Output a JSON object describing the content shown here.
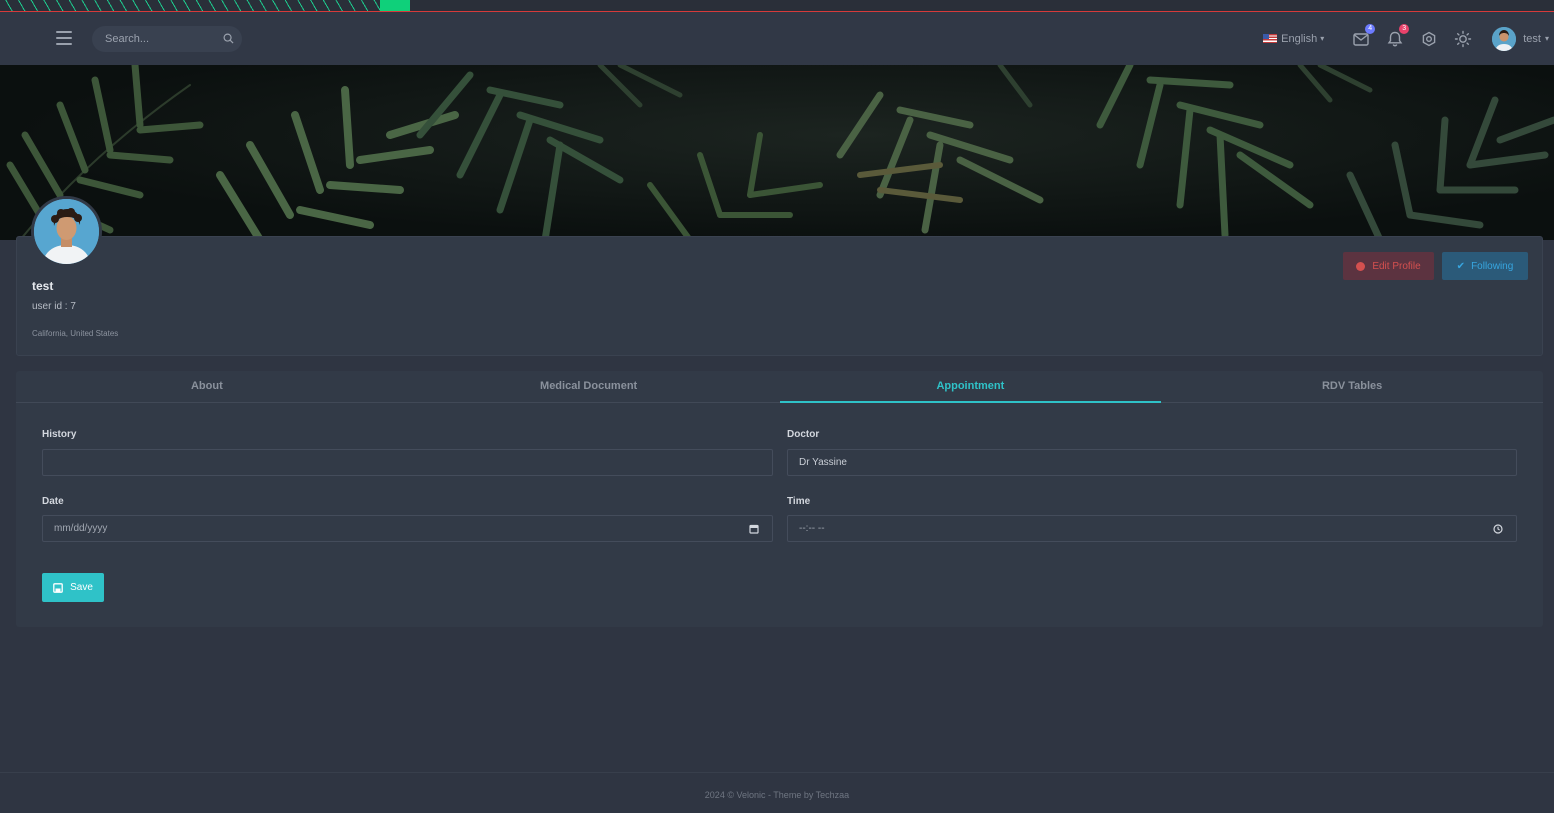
{
  "topbar": {
    "search_placeholder": "Search...",
    "language": "English",
    "messages_badge": "4",
    "notifications_badge": "3",
    "user_name": "test"
  },
  "profile": {
    "name": "test",
    "user_id": "user id : 7",
    "location": "California, United States",
    "edit_label": "Edit Profile",
    "follow_label": "Following"
  },
  "tabs": [
    {
      "label": "About",
      "active": false
    },
    {
      "label": "Medical Document",
      "active": false
    },
    {
      "label": "Appointment",
      "active": true
    },
    {
      "label": "RDV Tables",
      "active": false
    }
  ],
  "form": {
    "history_label": "History",
    "history_value": "",
    "doctor_label": "Doctor",
    "doctor_value": "Dr Yassine",
    "date_label": "Date",
    "date_placeholder": "mm/dd/yyyy",
    "time_label": "Time",
    "time_placeholder": "--:-- --",
    "save_label": "Save"
  },
  "footer": {
    "text": "2024 © Velonic - Theme by Techzaa"
  },
  "colors": {
    "accent": "#2fc2c8",
    "danger": "#d4504f",
    "info": "#37a6e0",
    "background": "#2f3542"
  }
}
